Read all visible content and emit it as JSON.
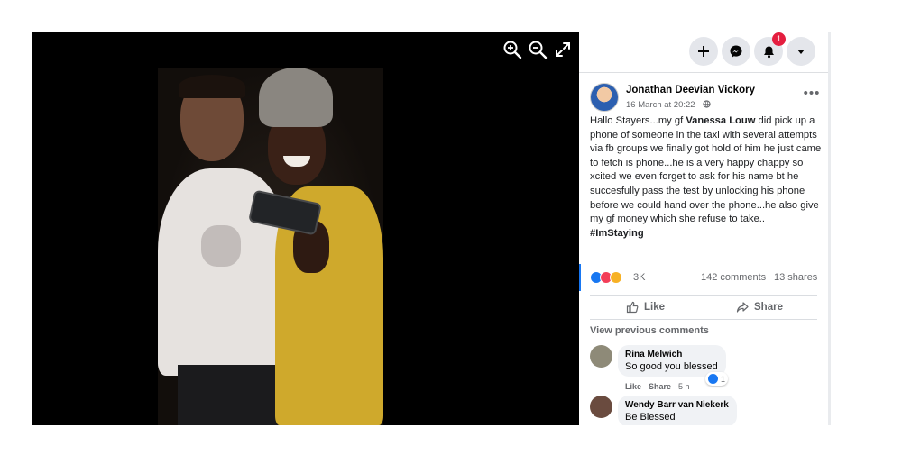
{
  "viewer": {
    "tools": [
      {
        "name": "zoom-in",
        "icon": "zoom-in-icon"
      },
      {
        "name": "zoom-out",
        "icon": "zoom-out-icon"
      },
      {
        "name": "fullscreen",
        "icon": "expand-icon"
      }
    ]
  },
  "topbar": {
    "buttons": [
      "plus-icon",
      "messenger-icon",
      "bell-icon",
      "caret-down-icon"
    ],
    "notification_count": "1"
  },
  "post": {
    "author": "Jonathan Deevian Vickory",
    "date": "16 March at 20:22",
    "privacy_dot": "·",
    "body_1": "Hallo Stayers...my gf ",
    "mention": "Vanessa Louw",
    "body_2": " did pick up a phone of someone in the taxi with several attempts via fb groups we finally got hold of him he just came to fetch is phone...he is a very happy chappy so xcited we even forget to ask for his name bt he succesfully pass the test by unlocking his phone before we could hand over the phone...he also give my gf money which she refuse to take..",
    "hashtag": "#ImStaying",
    "reaction_count": "3K",
    "comments_count": "142 comments",
    "shares_count": "13 shares"
  },
  "actions": {
    "like_label": "Like",
    "share_label": "Share"
  },
  "comments_section": {
    "view_previous": "View previous comments",
    "items": [
      {
        "name": "Rina Melwich",
        "text": "So good you blessed",
        "like": "Like",
        "share": "Share",
        "time": "5 h",
        "reactions": "1"
      },
      {
        "name": "Wendy Barr van Niekerk",
        "text": "Be Blessed"
      }
    ]
  },
  "colors": {
    "accent": "#1877f2",
    "badge": "#e41e3f",
    "muted": "#65676b"
  }
}
